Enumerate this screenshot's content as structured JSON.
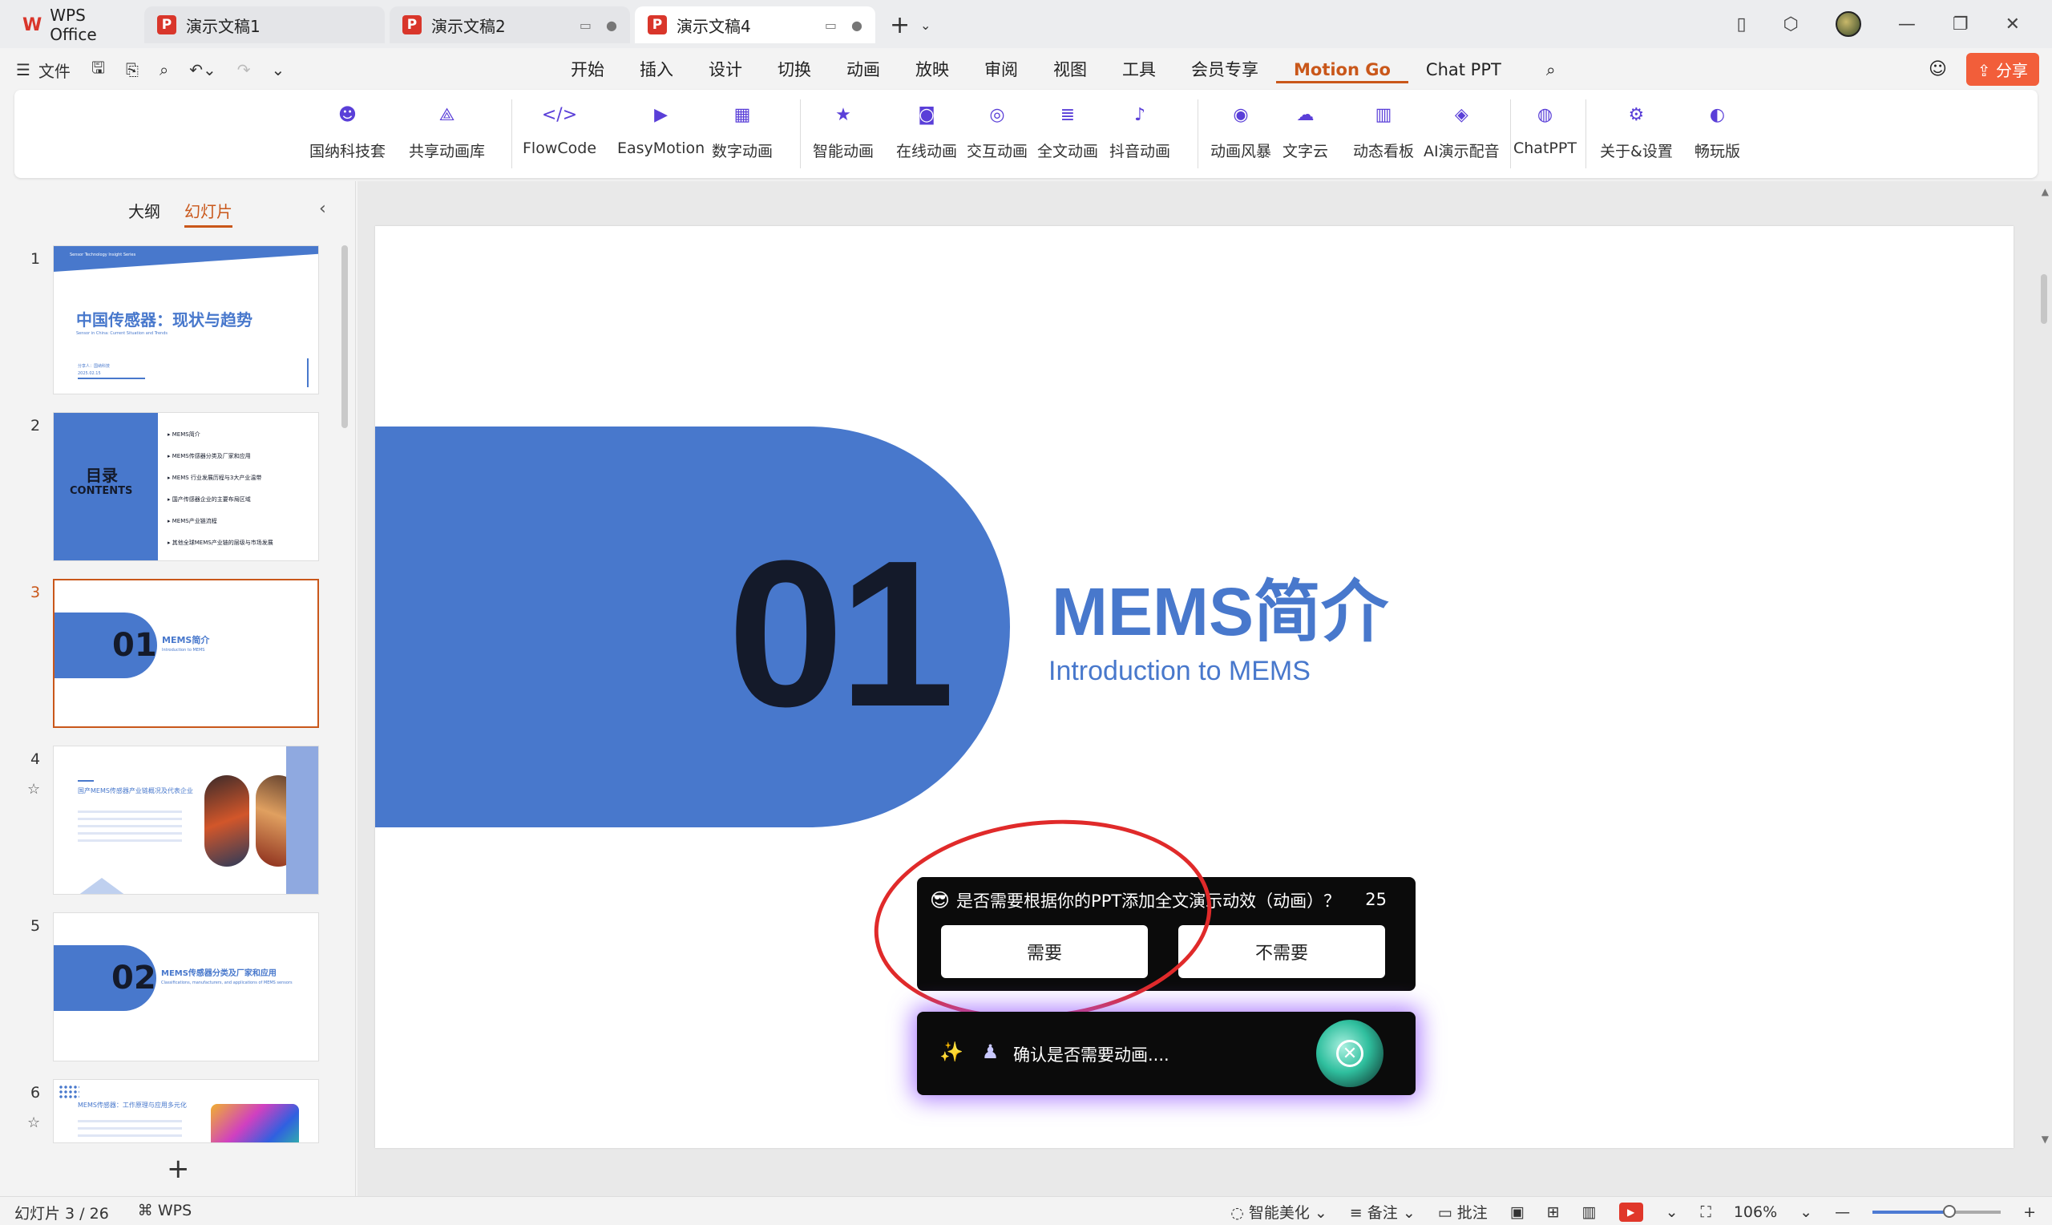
{
  "titlebar": {
    "brand": "WPS Office",
    "tabs": [
      {
        "label": "演示文稿1"
      },
      {
        "label": "演示文稿2"
      },
      {
        "label": "演示文稿4"
      }
    ]
  },
  "menubar": {
    "file": "文件",
    "tabs": [
      "开始",
      "插入",
      "设计",
      "切换",
      "动画",
      "放映",
      "审阅",
      "视图",
      "工具",
      "会员专享",
      "Motion Go",
      "Chat PPT"
    ],
    "active_tab": "Motion Go",
    "share": "分享"
  },
  "ribbon": {
    "items": [
      {
        "label": "国纳科技套",
        "icon": "avatar-icon"
      },
      {
        "label": "共享动画库",
        "icon": "share-network-icon"
      },
      {
        "label": "FlowCode",
        "icon": "code-icon"
      },
      {
        "label": "EasyMotion",
        "icon": "video-icon"
      },
      {
        "label": "数字动画",
        "icon": "digital-icon"
      },
      {
        "label": "智能动画",
        "icon": "smart-star-icon"
      },
      {
        "label": "在线动画",
        "icon": "online-icon"
      },
      {
        "label": "交互动画",
        "icon": "interactive-icon"
      },
      {
        "label": "全文动画",
        "icon": "fulltext-icon"
      },
      {
        "label": "抖音动画",
        "icon": "tiktok-icon"
      },
      {
        "label": "动画风暴",
        "icon": "storm-icon"
      },
      {
        "label": "文字云",
        "icon": "wordcloud-icon"
      },
      {
        "label": "动态看板",
        "icon": "dashboard-icon"
      },
      {
        "label": "AI演示配音",
        "icon": "voice-icon"
      },
      {
        "label": "ChatPPT",
        "icon": "chat-icon"
      },
      {
        "label": "关于&设置",
        "icon": "settings-icon"
      },
      {
        "label": "畅玩版",
        "icon": "toggle-icon"
      }
    ]
  },
  "leftpanel": {
    "tab_outline": "大纲",
    "tab_slides": "幻灯片",
    "slides": [
      {
        "num": "1",
        "title": "中国传感器：现状与趋势",
        "subtitle": "Sensor in China: Current Situation and Trends",
        "header": "Sensor Technology Insight Series",
        "author": "分享人：国纳科技",
        "date": "2025.02.15"
      },
      {
        "num": "2",
        "title": "目录",
        "subtitle": "CONTENTS",
        "items": [
          "MEMS简介",
          "MEMS传感器分类及厂家和应用",
          "MEMS 行业发展历程与3大产业温带",
          "国产传感器企业的主要布局区域",
          "MEMS产业链流程",
          "其他全球MEMS产业链的层级与市场发展"
        ]
      },
      {
        "num": "3",
        "big": "01",
        "title": "MEMS简介",
        "subtitle": "Introduction to MEMS"
      },
      {
        "num": "4",
        "title": "国产MEMS传感器产业链概况及代表企业"
      },
      {
        "num": "5",
        "big": "02",
        "title": "MEMS传感器分类及厂家和应用",
        "subtitle": "Classifications, manufacturers, and applications of MEMS sensors"
      },
      {
        "num": "6",
        "title": "MEMS传感器：工作原理与应用多元化"
      }
    ]
  },
  "slide": {
    "number": "01",
    "title": "MEMS简介",
    "subtitle": "Introduction to MEMS"
  },
  "dialog": {
    "emoji": "😎",
    "question": "是否需要根据你的PPT添加全文演示动效（动画）？",
    "countdown": "25",
    "yes": "需要",
    "no": "不需要"
  },
  "toast": {
    "text": "确认是否需要动画...."
  },
  "statusbar": {
    "slide_info": "幻灯片 3 / 26",
    "app": "WPS",
    "beautify": "智能美化",
    "notes": "备注",
    "comments": "批注",
    "zoom": "106%",
    "zoom_level": 0.6
  }
}
